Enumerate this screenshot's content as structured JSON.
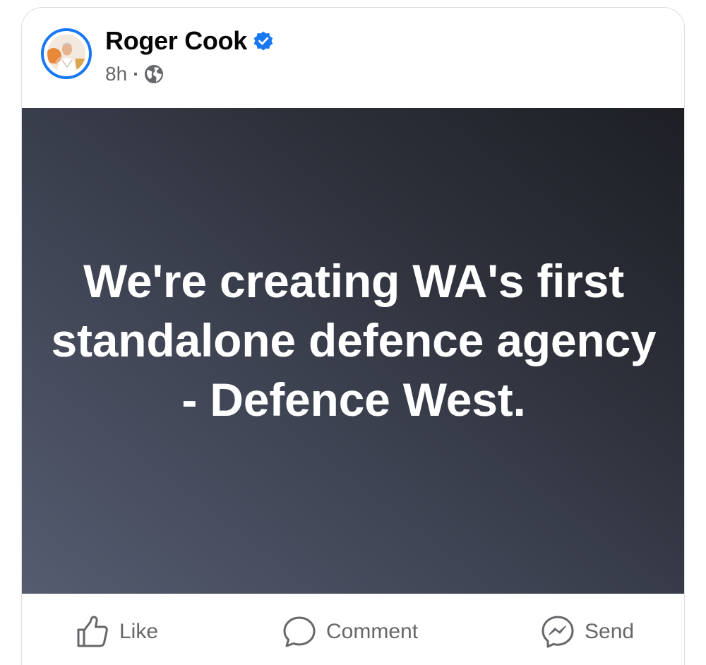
{
  "post": {
    "author": "Roger Cook",
    "time": "8h",
    "separator": "·",
    "audience_icon": "globe-icon",
    "verified_icon": "verified-badge-icon",
    "image_text": "We're creating WA's first standalone defence agency - Defence West."
  },
  "actions": {
    "like_label": "Like",
    "comment_label": "Comment",
    "send_label": "Send"
  },
  "colors": {
    "brand_blue": "#1877f2",
    "meta_gray": "#65676b",
    "image_dark": "#1d1f25",
    "image_light": "#555c70"
  }
}
